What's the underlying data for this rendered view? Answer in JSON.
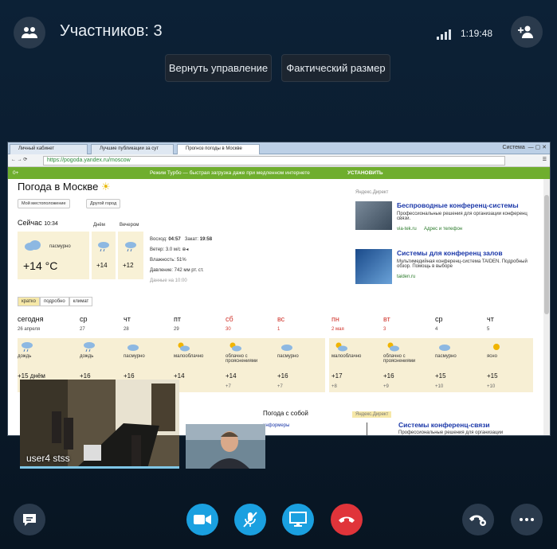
{
  "header": {
    "participants_label": "Участников: 3",
    "call_timer": "1:19:48"
  },
  "toolbar": {
    "return_control_label": "Вернуть управление",
    "actual_size_label": "Фактический размер"
  },
  "shared_screen": {
    "tabs": [
      {
        "label": "Личный кабинет"
      },
      {
        "label": "Лучшие публикации за сут"
      },
      {
        "label": "Прогноз погоды в Москве"
      }
    ],
    "window_label": "Система",
    "url": "https://pogoda.yandex.ru/moscow",
    "turbo": {
      "left": "0+",
      "message": "Режим Турбо — быстрая загрузка даже при медленном интернете",
      "install": "УСТАНОВИТЬ"
    },
    "page": {
      "title": "Погода в Москве",
      "my_location_btn": "Мой местоположение",
      "other_city_btn": "Другой город",
      "now_label": "Сейчас",
      "now_time": "10:34",
      "day_label": "Днём",
      "evening_label": "Вечером",
      "now_condition": "пасмурно",
      "now_temp": "+14 °C",
      "day_temp": "+14",
      "evening_temp": "+12",
      "sunrise_label": "Восход:",
      "sunrise": "04:57",
      "sunset_label": "Закат:",
      "sunset": "19:58",
      "wind_label": "Ветер:",
      "wind": "3.0 м/с",
      "humidity_label": "Влажность:",
      "humidity": "51%",
      "pressure_label": "Давление:",
      "pressure": "742 мм рт. ст.",
      "data_note": "Данные на 10:00",
      "view_tabs": [
        "кратко",
        "подробно",
        "климат"
      ],
      "forecast": [
        {
          "day": "сегодня",
          "date": "26 апреля",
          "cond": "дождь",
          "temp": "+15 днём",
          "night": "",
          "red": false
        },
        {
          "day": "ср",
          "date": "27",
          "cond": "дождь",
          "temp": "+16",
          "night": "",
          "red": false
        },
        {
          "day": "чт",
          "date": "28",
          "cond": "пасмурно",
          "temp": "+16",
          "night": "",
          "red": false
        },
        {
          "day": "пт",
          "date": "29",
          "cond": "малооблачно",
          "temp": "+14",
          "night": "+7",
          "red": false
        },
        {
          "day": "сб",
          "date": "30",
          "cond": "облачно с прояснениями",
          "temp": "+14",
          "night": "+7",
          "red": true
        },
        {
          "day": "вс",
          "date": "1",
          "cond": "пасмурно",
          "temp": "+16",
          "night": "+7",
          "red": true
        },
        {
          "day": "пн",
          "date": "2 мая",
          "cond": "малооблачно",
          "temp": "+17",
          "night": "+8",
          "red": true
        },
        {
          "day": "вт",
          "date": "3",
          "cond": "облачно с прояснениями",
          "temp": "+16",
          "night": "+9",
          "red": true
        },
        {
          "day": "ср",
          "date": "4",
          "cond": "пасмурно",
          "temp": "+15",
          "night": "+10",
          "red": false
        },
        {
          "day": "чт",
          "date": "5",
          "cond": "ясно",
          "temp": "+15",
          "night": "+10",
          "red": false
        }
      ],
      "weather_with_you": "Погода с собой",
      "informers": "информеры"
    },
    "ads": {
      "header": "Яндекс.Директ",
      "ad1_title": "Беспроводные конференц-системы",
      "ad1_text": "Профессиональные решения для организации конференц связи.",
      "ad1_domain": "via-tek.ru",
      "ad1_link": "Адрес и телефон",
      "ad2_title": "Системы для конференц залов",
      "ad2_text": "Мультимедийная конференц-система TAIDEN. Подробный обзор. Помощь в выборе",
      "ad2_domain": "taiden.ru",
      "bottom_header": "Яндекс.Директ",
      "ad3_title": "Системы конференц-связи",
      "ad3_text": "Профессиональные решения для организации"
    }
  },
  "participant": {
    "name": "user4 stss"
  },
  "colors": {
    "accent_blue": "#1aa0e0",
    "end_call_red": "#e0343a",
    "button_dark": "#2a3a4c"
  },
  "icons": {
    "participants": "people-icon",
    "add_person": "add-person-icon",
    "chat": "chat-icon",
    "video": "video-camera-icon",
    "mute": "microphone-muted-icon",
    "screen_share": "screen-share-icon",
    "end_call": "phone-hangup-icon",
    "call_settings": "phone-gear-icon",
    "more": "more-icon"
  }
}
